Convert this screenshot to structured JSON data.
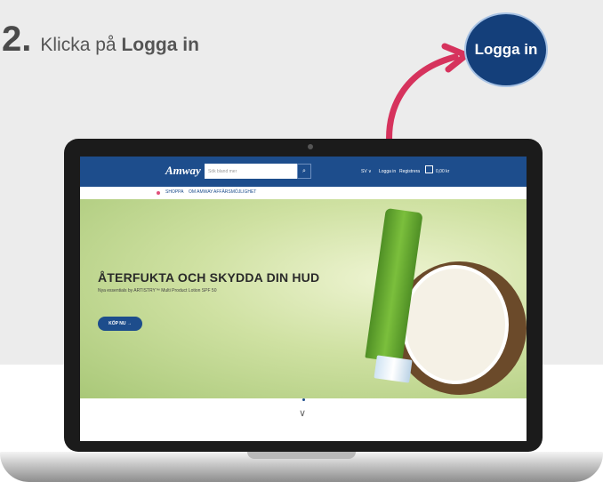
{
  "instruction": {
    "step_number": "2",
    "step_dot": ".",
    "text_prefix": "Klicka på",
    "text_bold": "Logga in"
  },
  "callout": {
    "label": "Logga in",
    "color": "#143f7a",
    "arrow_color": "#d6335d"
  },
  "site": {
    "brand": "Amway",
    "search_placeholder": "Sök bland mer",
    "header_color": "#1d4d8c",
    "utility": {
      "language": "SV ∨",
      "login": "Logga in",
      "register": "Registrera",
      "cart": "0,00 kr"
    },
    "nav": [
      "SHOPPA",
      "OM AMWAY",
      "AFFÄRSMÖJLIGHET"
    ],
    "hero": {
      "headline": "ÅTERFUKTA OCH SKYDDA DIN HUD",
      "subline": "Nya essentials by ARTISTRY™ Multi Product Lotion SPF 50",
      "cta": "KÖP NU →",
      "slide_indicators": [
        "active",
        "inactive"
      ]
    },
    "scroll_icon": "chevron-down-icon"
  }
}
